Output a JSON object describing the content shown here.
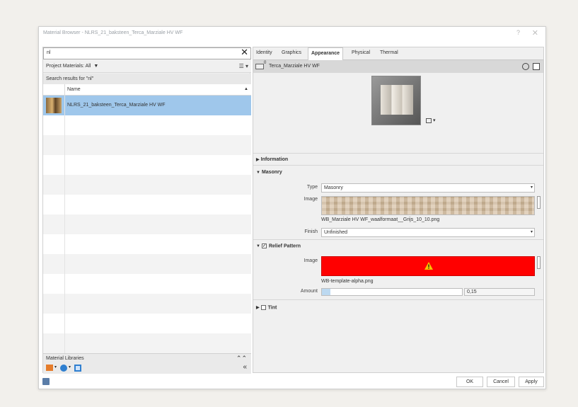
{
  "window": {
    "title": "Material Browser - NLRS_21_baksteen_Terca_Marziale HV WF",
    "help_label": "?",
    "close_label": "✕"
  },
  "left": {
    "search": {
      "value": "nl",
      "clear_label": "✕"
    },
    "project_materials": {
      "label": "Project Materials: All",
      "filter_label": "▼",
      "view_label": "☰ ▾"
    },
    "search_results_label": "Search results for \"nl\"",
    "columns": {
      "name": "Name",
      "sort": "▲"
    },
    "rows": [
      {
        "name": "NLRS_21_baksteen_Terca_Marziale HV WF"
      }
    ],
    "libraries": {
      "label": "Material Libraries",
      "collapse": "⌃⌃",
      "hide": "«"
    },
    "lib_toolbar": {
      "caret1": "▾",
      "caret2": "▾"
    }
  },
  "right": {
    "tabs": [
      {
        "label": "Identity"
      },
      {
        "label": "Graphics"
      },
      {
        "label": "Appearance"
      },
      {
        "label": "Physical"
      },
      {
        "label": "Thermal"
      }
    ],
    "header": {
      "count": "0",
      "name": "Terca_Marziale HV WF"
    },
    "preview_menu": "▾",
    "sections": {
      "information": "Information",
      "masonry": "Masonry",
      "relief": "Relief Pattern",
      "tint": "Tint"
    },
    "masonry": {
      "type_label": "Type",
      "type_value": "Masonry",
      "image_label": "Image",
      "image_file": "WB_Marziale HV WF_waalformaat__Grijs_10_10.png",
      "finish_label": "Finish",
      "finish_value": "Unfinished"
    },
    "relief": {
      "image_label": "Image",
      "image_file": "WB-template-alpha.png",
      "amount_label": "Amount",
      "amount_value": "0,15",
      "amount_fraction": 0.02
    }
  },
  "footer": {
    "ok": "OK",
    "cancel": "Cancel",
    "apply": "Apply"
  }
}
